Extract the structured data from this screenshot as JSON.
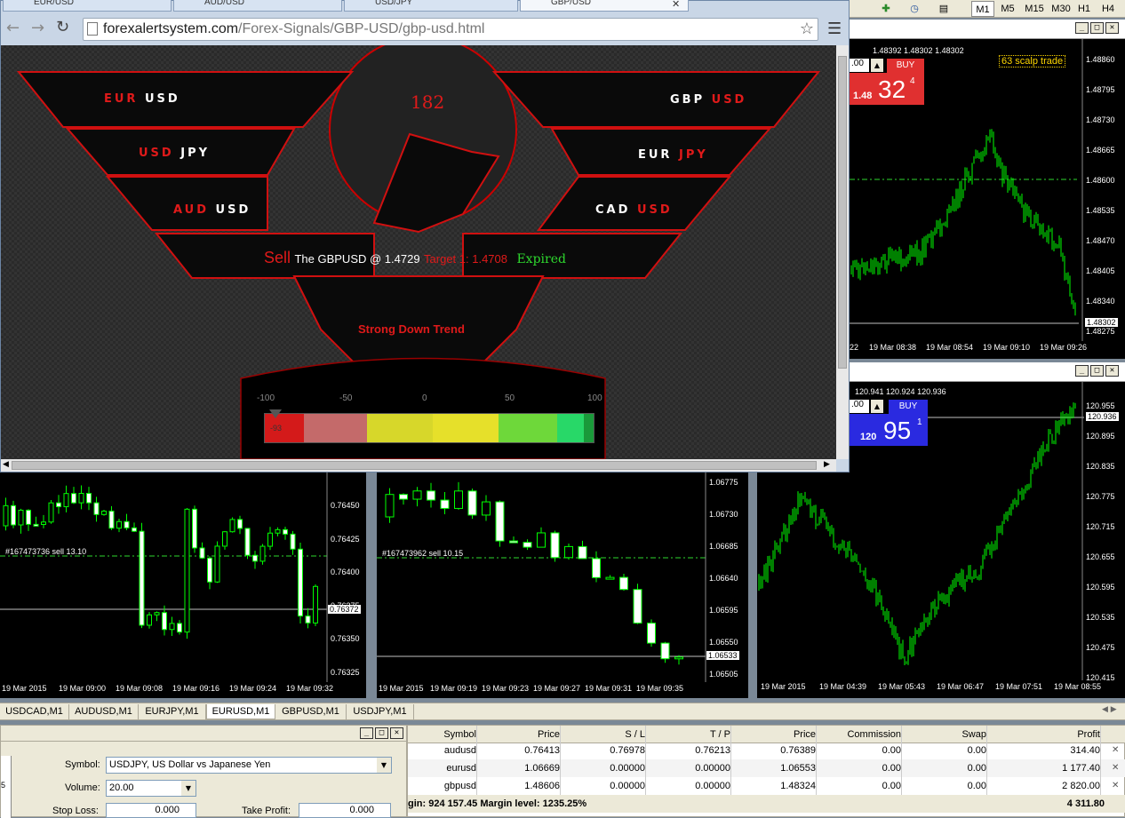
{
  "browser": {
    "tabs": [
      "EUR/USD",
      "AUD/USD",
      "USD/JPY",
      "GBP/USD"
    ],
    "url_domain": "forexalertsystem.com",
    "url_path": "/Forex-Signals/GBP-USD/gbp-usd.html",
    "counter": "182",
    "pairs": {
      "left": [
        [
          "EUR",
          "USD"
        ],
        [
          "USD",
          "JPY"
        ],
        [
          "AUD",
          "USD"
        ]
      ],
      "right": [
        [
          "GBP",
          "USD"
        ],
        [
          "EUR",
          "JPY"
        ],
        [
          "CAD",
          "USD"
        ]
      ]
    },
    "signal": {
      "action": "Sell",
      "text": "The GBPUSD @ 1.4729",
      "target": "Target 1: 1.4708",
      "status": "Expired"
    },
    "trend": "Strong Down Trend",
    "meter": {
      "ticks": [
        "-100",
        "-50",
        "0",
        "50",
        "100"
      ],
      "value": "-93",
      "level": -93
    }
  },
  "toolbar": {
    "timeframes": [
      "M1",
      "M5",
      "M15",
      "M30",
      "H1",
      "H4"
    ]
  },
  "charts": {
    "gbpusd": {
      "ohlc": "1.48392 1.48302 1.48302",
      "lot": ".00",
      "buy_label": "BUY",
      "price_big": "32",
      "price_prefix": "1.48",
      "price_sup": "4",
      "note": "63 scalp trade",
      "price_scale": [
        "1.48860",
        "1.48795",
        "1.48730",
        "1.48665",
        "1.48600",
        "1.48535",
        "1.48470",
        "1.48405",
        "1.48340",
        "1.48275"
      ],
      "current": "1.48302",
      "time_scale": [
        "22",
        "19 Mar 08:38",
        "19 Mar 08:54",
        "19 Mar 09:10",
        "19 Mar 09:26"
      ]
    },
    "usdjpy": {
      "ohlc": "120.941 120.924 120.936",
      "lot": ".00",
      "buy_label": "BUY",
      "price_big": "95",
      "price_prefix": "120",
      "price_sup": "1",
      "price_scale": [
        "120.955",
        "120.895",
        "120.835",
        "120.775",
        "120.715",
        "120.655",
        "120.595",
        "120.535",
        "120.475",
        "120.415"
      ],
      "current": "120.936",
      "time_scale": [
        "19 Mar 2015",
        "19 Mar 04:39",
        "19 Mar 05:43",
        "19 Mar 06:47",
        "19 Mar 07:51",
        "19 Mar 08:55"
      ]
    },
    "audusd": {
      "order_label": "#167473736 sell 13.10",
      "price_scale": [
        "0.76450",
        "0.76425",
        "0.76400",
        "0.76375",
        "0.76350",
        "0.76325"
      ],
      "current": "0.76372",
      "time_scale": [
        "19 Mar 2015",
        "19 Mar 09:00",
        "19 Mar 09:08",
        "19 Mar 09:16",
        "19 Mar 09:24",
        "19 Mar 09:32"
      ]
    },
    "eurusd": {
      "order_label": "#167473962 sell 10.15",
      "price_scale": [
        "1.06775",
        "1.06730",
        "1.06685",
        "1.06640",
        "1.06595",
        "1.06550",
        "1.06505"
      ],
      "current": "1.06533",
      "time_scale": [
        "19 Mar 2015",
        "19 Mar 09:19",
        "19 Mar 09:23",
        "19 Mar 09:27",
        "19 Mar 09:31",
        "19 Mar 09:35"
      ]
    }
  },
  "symbol_tabs": [
    "USDCAD,M1",
    "AUDUSD,M1",
    "EURJPY,M1",
    "EURUSD,M1",
    "GBPUSD,M1",
    "USDJPY,M1"
  ],
  "order": {
    "symbol_label": "Symbol:",
    "symbol_value": "USDJPY, US Dollar vs Japanese Yen",
    "volume_label": "Volume:",
    "volume_value": "20.00",
    "sl_label": "Stop Loss:",
    "sl_value": "0.000",
    "tp_label": "Take Profit:",
    "tp_value": "0.000",
    "left_digit": "5"
  },
  "terminal": {
    "headers": [
      "Symbol",
      "Price",
      "S / L",
      "T / P",
      "Price",
      "Commission",
      "Swap",
      "Profit"
    ],
    "rows": [
      [
        "audusd",
        "0.76413",
        "0.76978",
        "0.76213",
        "0.76389",
        "0.00",
        "0.00",
        "314.40"
      ],
      [
        "eurusd",
        "1.06669",
        "0.00000",
        "0.00000",
        "1.06553",
        "0.00",
        "0.00",
        "1 177.40"
      ],
      [
        "gbpusd",
        "1.48606",
        "0.00000",
        "0.00000",
        "1.48324",
        "0.00",
        "0.00",
        "2 820.00"
      ]
    ],
    "summary": "gin: 924 157.45  Margin level: 1235.25%",
    "total": "4 311.80"
  },
  "colors": {
    "candle_up": "#00ff00",
    "sell_red": "#e01a1a",
    "buy_red": "#e03030",
    "buy_blue": "#2a2ae0"
  }
}
